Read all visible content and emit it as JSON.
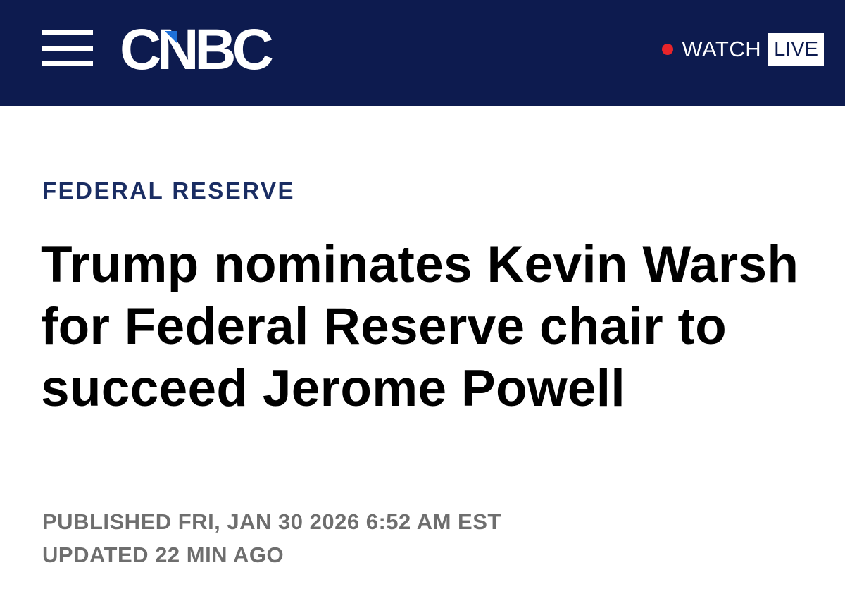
{
  "header": {
    "brand": "CNBC",
    "watch_label": "WATCH",
    "live_label": "LIVE",
    "menu_icon": "hamburger-menu-icon",
    "live_dot_color": "#e8242a",
    "background_color": "#0d1b4f"
  },
  "article": {
    "kicker": "FEDERAL RESERVE",
    "headline": "Trump nominates Kevin Warsh for Federal Reserve chair to succeed Jerome Powell",
    "published": "PUBLISHED FRI, JAN 30 2026 6:52 AM EST",
    "updated": "UPDATED 22 MIN AGO",
    "kicker_color": "#1a2d63"
  }
}
